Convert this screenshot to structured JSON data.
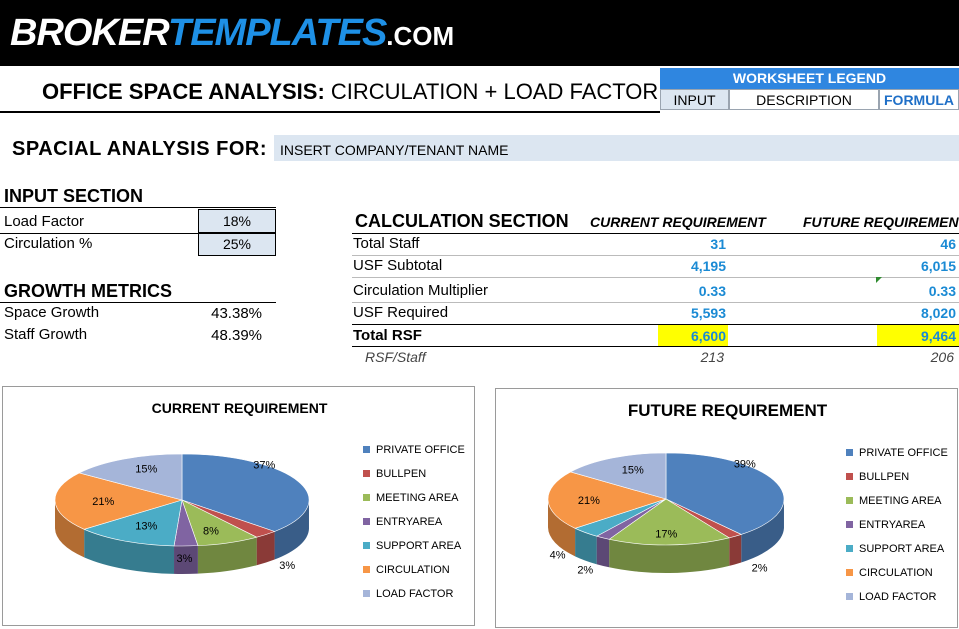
{
  "brand": {
    "part1": "BROKER",
    "part2": "TEMPLATES",
    "part3": ".COM"
  },
  "title": {
    "bold": "OFFICE SPACE ANALYSIS:",
    "rest": " CIRCULATION + LOAD FACTOR"
  },
  "legend": {
    "header": "WORKSHEET LEGEND",
    "input": "INPUT",
    "description": "DESCRIPTION",
    "formula": "FORMULA"
  },
  "spacial": {
    "label": "SPACIAL ANALYSIS FOR:",
    "value": "INSERT COMPANY/TENANT NAME"
  },
  "input_section": {
    "title": "INPUT SECTION",
    "rows": [
      {
        "label": "Load Factor",
        "value": "18%"
      },
      {
        "label": "Circulation %",
        "value": "25%"
      }
    ]
  },
  "growth": {
    "title": "GROWTH METRICS",
    "rows": [
      {
        "label": "Space Growth",
        "value": "43.38%"
      },
      {
        "label": "Staff Growth",
        "value": "48.39%"
      }
    ]
  },
  "calc": {
    "title": "CALCULATION SECTION",
    "col_current": "CURRENT REQUIREMENT",
    "col_future": "FUTURE REQUIREMENT",
    "rows": [
      {
        "label": "Total Staff",
        "current": "31",
        "future": "46"
      },
      {
        "label": "USF Subtotal",
        "current": "4,195",
        "future": "6,015"
      },
      {
        "label": "Circulation Multiplier",
        "current": "0.33",
        "future": "0.33"
      },
      {
        "label": "USF Required",
        "current": "5,593",
        "future": "8,020"
      },
      {
        "label": "Total RSF",
        "current": "6,600",
        "future": "9,464"
      },
      {
        "label": "RSF/Staff",
        "current": "213",
        "future": "206"
      }
    ]
  },
  "colors": {
    "private_office": "#4f81bd",
    "bullpen": "#c0504d",
    "meeting_area": "#9bbb59",
    "entryarea": "#8064a2",
    "support_area": "#4bacc6",
    "circulation": "#f79646",
    "load_factor": "#a5b5d9"
  },
  "chart_data": [
    {
      "type": "pie",
      "title": "CURRENT REQUIREMENT",
      "legend": [
        "PRIVATE OFFICE",
        "BULLPEN",
        "MEETING  AREA",
        "ENTRYAREA",
        "SUPPORT AREA",
        "CIRCULATION",
        "LOAD FACTOR"
      ],
      "values": [
        37,
        3,
        8,
        3,
        13,
        21,
        15
      ],
      "labels": [
        "37%",
        "3%",
        "8%",
        "3%",
        "13%",
        "21%",
        "15%"
      ],
      "legend_placement": "right"
    },
    {
      "type": "pie",
      "title": "FUTURE REQUIREMENT",
      "legend": [
        "PRIVATE OFFICE",
        "BULLPEN",
        "MEETING  AREA",
        "ENTRYAREA",
        "SUPPORT AREA",
        "CIRCULATION",
        "LOAD FACTOR"
      ],
      "values": [
        39,
        2,
        17,
        2,
        4,
        21,
        15
      ],
      "labels": [
        "39%",
        "2%",
        "17%",
        "2%",
        "4%",
        "21%",
        "15%"
      ],
      "legend_placement": "right"
    }
  ]
}
